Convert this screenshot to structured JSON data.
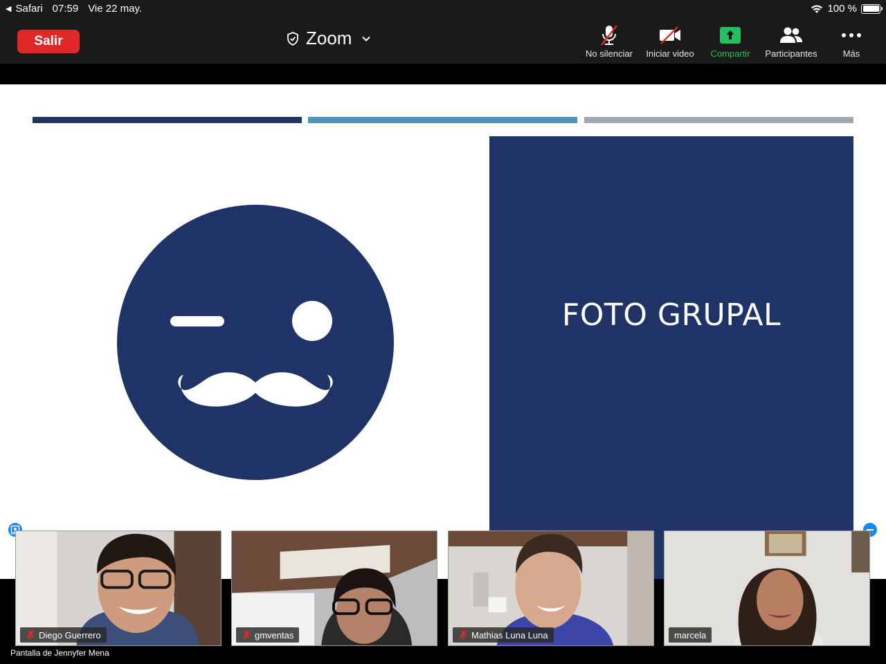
{
  "status_bar": {
    "back_app": "Safari",
    "time": "07:59",
    "date": "Vie 22 may.",
    "battery": "100 %"
  },
  "toolbar": {
    "leave_label": "Salir",
    "app_title": "Zoom",
    "unmute_label": "No silenciar",
    "start_video_label": "Iniciar video",
    "share_label": "Compartir",
    "participants_label": "Participantes",
    "more_label": "Más"
  },
  "slide": {
    "title": "FOTO GRUPAL"
  },
  "participants": [
    {
      "name": "Diego Guerrero",
      "muted": true
    },
    {
      "name": "gmventas",
      "muted": true
    },
    {
      "name": "Mathias Luna Luna",
      "muted": true
    },
    {
      "name": "marcela",
      "muted": false
    }
  ],
  "screen_owner_label": "Pantalla de Jennyfer Mena",
  "colors": {
    "leave_red": "#e02828",
    "share_green": "#22c15e",
    "slide_navy": "#1f3366",
    "slide_light_blue": "#4d93c2",
    "slide_gray": "#a3a8ae"
  }
}
